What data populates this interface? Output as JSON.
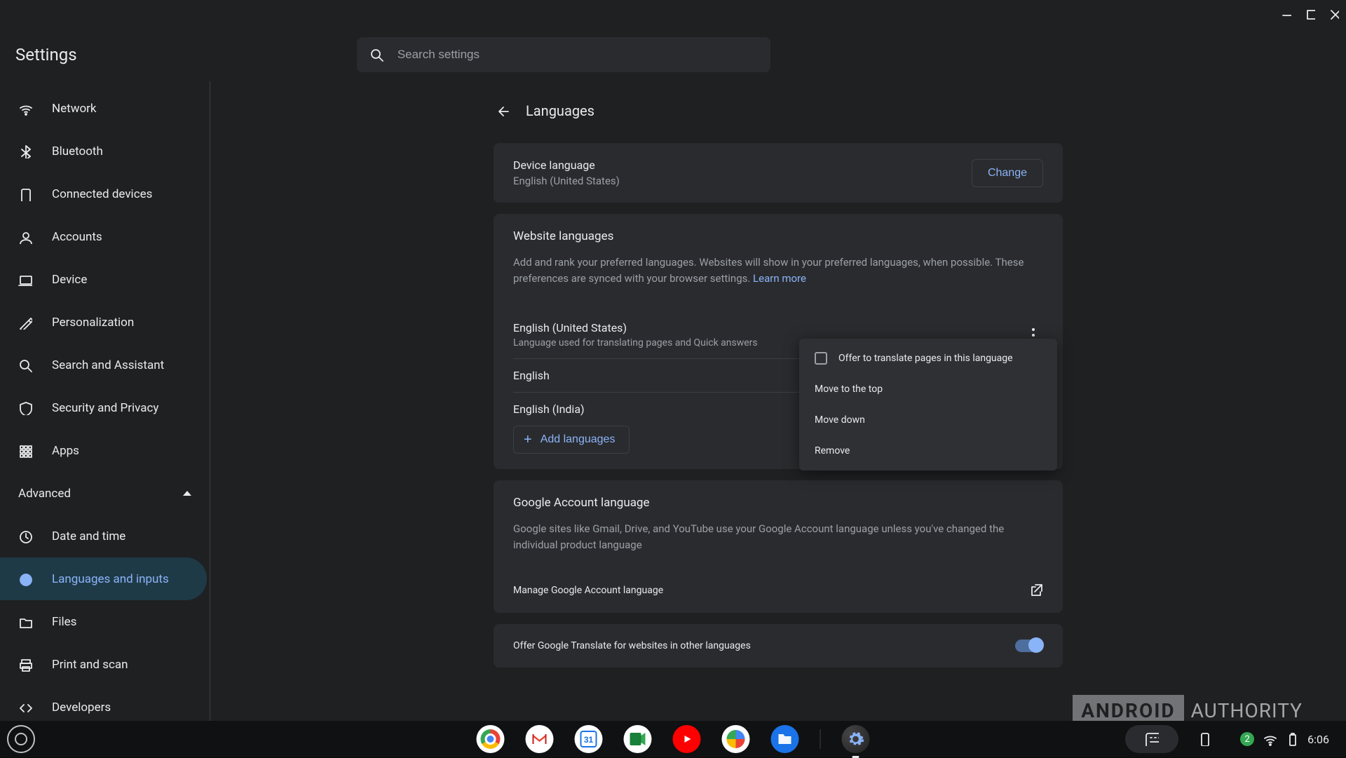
{
  "app_title": "Settings",
  "search": {
    "placeholder": "Search settings"
  },
  "sidebar": {
    "items": [
      {
        "id": "network",
        "label": "Network"
      },
      {
        "id": "bluetooth",
        "label": "Bluetooth"
      },
      {
        "id": "connected-devices",
        "label": "Connected devices"
      },
      {
        "id": "accounts",
        "label": "Accounts"
      },
      {
        "id": "device",
        "label": "Device"
      },
      {
        "id": "personalization",
        "label": "Personalization"
      },
      {
        "id": "search-assistant",
        "label": "Search and Assistant"
      },
      {
        "id": "security-privacy",
        "label": "Security and Privacy"
      },
      {
        "id": "apps",
        "label": "Apps"
      }
    ],
    "advanced_label": "Advanced",
    "advanced_items": [
      {
        "id": "date-time",
        "label": "Date and time"
      },
      {
        "id": "languages-inputs",
        "label": "Languages and inputs",
        "selected": true
      },
      {
        "id": "files",
        "label": "Files"
      },
      {
        "id": "print-scan",
        "label": "Print and scan"
      },
      {
        "id": "developers",
        "label": "Developers"
      }
    ]
  },
  "page": {
    "title": "Languages",
    "device_language": {
      "label": "Device language",
      "value": "English (United States)",
      "change": "Change"
    },
    "website_languages": {
      "title": "Website languages",
      "description": "Add and rank your preferred languages. Websites will show in your preferred languages, when possible. These preferences are synced with your browser settings. ",
      "learn_more": "Learn more",
      "list": [
        {
          "name": "English (United States)",
          "sub": "Language used for translating pages and Quick answers"
        },
        {
          "name": "English"
        },
        {
          "name": "English (India)"
        }
      ],
      "add_button": "Add languages"
    },
    "context_menu": {
      "offer_translate": "Offer to translate pages in this language",
      "move_top": "Move to the top",
      "move_down": "Move down",
      "remove": "Remove"
    },
    "google_account": {
      "title": "Google Account language",
      "description": "Google sites like Gmail, Drive, and YouTube use your Google Account language unless you've changed the individual product language",
      "manage": "Manage Google Account language"
    },
    "offer_translate_toggle": {
      "label": "Offer Google Translate for websites in other languages",
      "value": true
    }
  },
  "watermark": {
    "android": "ANDROID",
    "authority": "AUTHORITY"
  },
  "shelf": {
    "notification_count": "2",
    "clock": "6:06"
  }
}
